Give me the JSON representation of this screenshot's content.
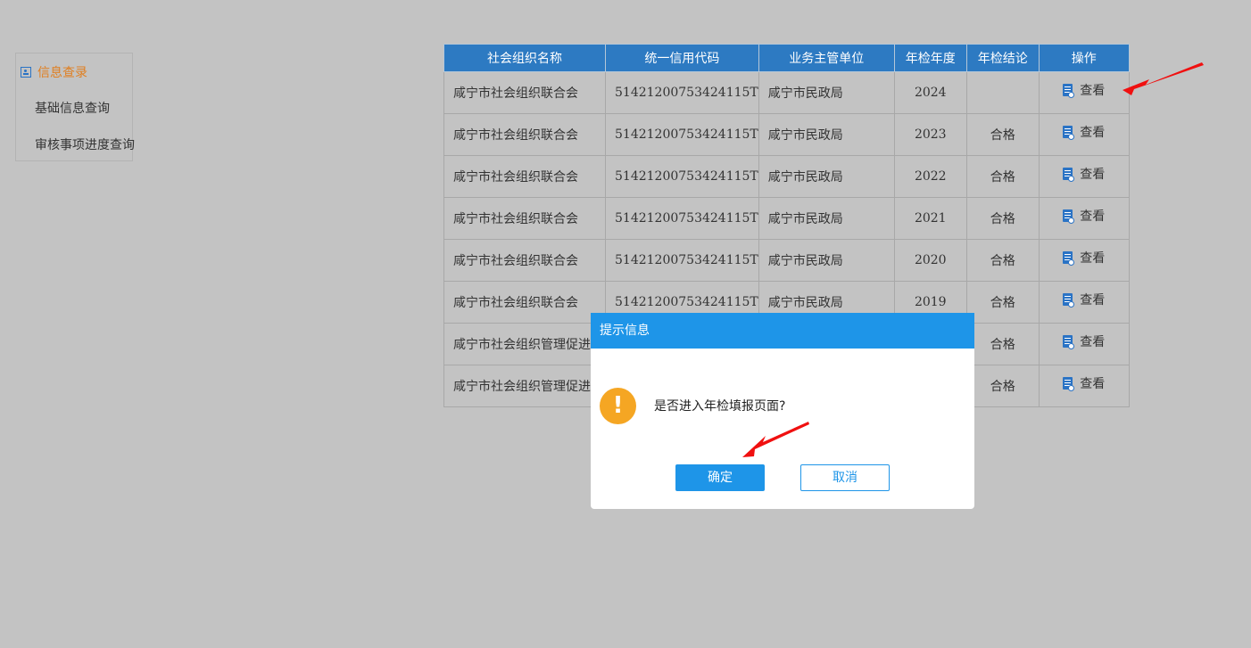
{
  "sidebar": {
    "header": "信息查录",
    "items": [
      {
        "label": "基础信息查询"
      },
      {
        "label": "审核事项进度查询"
      }
    ]
  },
  "table": {
    "columns": [
      "社会组织名称",
      "统一信用代码",
      "业务主管单位",
      "年检年度",
      "年检结论",
      "操作"
    ],
    "rows": [
      {
        "name": "咸宁市社会组织联合会",
        "code": "51421200753424115T",
        "org": "咸宁市民政局",
        "year": "2024",
        "result": "",
        "action": "查看"
      },
      {
        "name": "咸宁市社会组织联合会",
        "code": "51421200753424115T",
        "org": "咸宁市民政局",
        "year": "2023",
        "result": "合格",
        "action": "查看"
      },
      {
        "name": "咸宁市社会组织联合会",
        "code": "51421200753424115T",
        "org": "咸宁市民政局",
        "year": "2022",
        "result": "合格",
        "action": "查看"
      },
      {
        "name": "咸宁市社会组织联合会",
        "code": "51421200753424115T",
        "org": "咸宁市民政局",
        "year": "2021",
        "result": "合格",
        "action": "查看"
      },
      {
        "name": "咸宁市社会组织联合会",
        "code": "51421200753424115T",
        "org": "咸宁市民政局",
        "year": "2020",
        "result": "合格",
        "action": "查看"
      },
      {
        "name": "咸宁市社会组织联合会",
        "code": "51421200753424115T",
        "org": "咸宁市民政局",
        "year": "2019",
        "result": "合格",
        "action": "查看"
      },
      {
        "name": "咸宁市社会组织管理促进",
        "code": "",
        "org": "",
        "year": "",
        "result": "合格",
        "action": "查看"
      },
      {
        "name": "咸宁市社会组织管理促进",
        "code": "",
        "org": "",
        "year": "",
        "result": "合格",
        "action": "查看"
      }
    ]
  },
  "dialog": {
    "title": "提示信息",
    "icon": "!",
    "message": "是否进入年检填报页面?",
    "ok_label": "确定",
    "cancel_label": "取消"
  },
  "colors": {
    "header_bg": "#2d7ac2",
    "dialog_title_bg": "#1e95e8",
    "warning": "#f5a623",
    "annotation_arrow": "#f01010",
    "sidebar_active": "#e07f20",
    "overlay": "#c3c3c3"
  }
}
